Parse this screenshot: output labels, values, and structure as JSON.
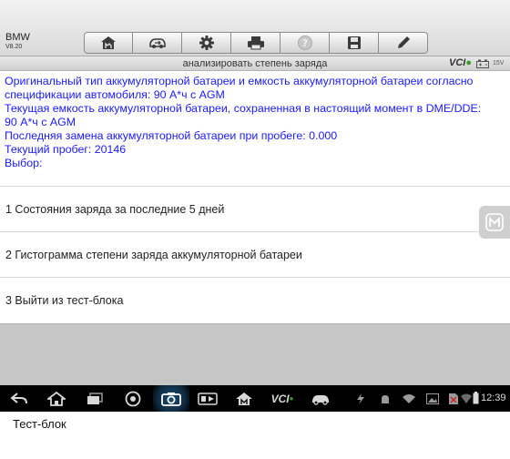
{
  "header": {
    "app_title": "BMW",
    "app_version": "V8.20",
    "toolbar": [
      {
        "icon": "home-icon",
        "label": "Home"
      },
      {
        "icon": "vehicle-swap-icon",
        "label": "Vehicle swap"
      },
      {
        "icon": "settings-icon",
        "label": "Settings"
      },
      {
        "icon": "print-icon",
        "label": "Print"
      },
      {
        "icon": "help-icon",
        "label": "Help"
      },
      {
        "icon": "save-icon",
        "label": "Save"
      },
      {
        "icon": "edit-icon",
        "label": "Edit"
      }
    ]
  },
  "subbar": {
    "title": "анализировать степень заряда",
    "vci_label": "VCI",
    "voltage": "15V"
  },
  "info_lines": [
    "Оригинальный тип аккумуляторной батареи и емкость аккумуляторной батареи согласно",
    "спецификации автомобиля:  90 А*ч с AGM",
    "Текущая емкость аккумуляторной батареи, сохраненная в настоящий момент в DME/DDE:",
    "90 А*ч с AGM",
    "Последняя замена аккумуляторной батареи при пробеге: 0.000",
    "Текущий пробег: 20146",
    "Выбор:"
  ],
  "menu_items": [
    "1 Состояния заряда за последние 5 дней",
    "2 Гистограмма степени заряда аккумуляторной батареи",
    "3 Выйти из тест-блока"
  ],
  "navbar": {
    "vci_label": "VCI",
    "clock": "12:39"
  },
  "caption": "Тест-блок",
  "colors": {
    "info_text": "#1a1aff",
    "grey_area": "#c6c6c6",
    "navbar": "#000000",
    "vci_green": "#3a9a2a"
  }
}
